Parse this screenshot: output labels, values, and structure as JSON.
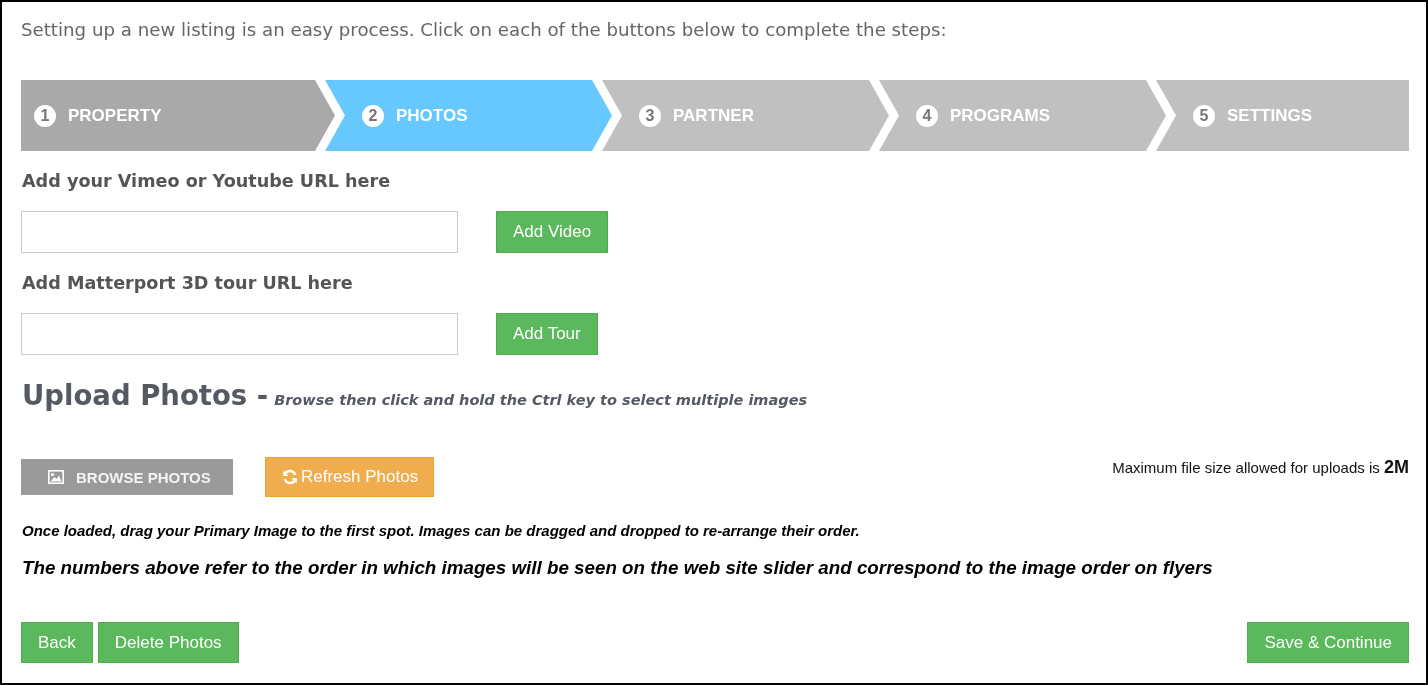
{
  "intro": "Setting up a new listing is an easy process. Click on each of the buttons below to complete the steps:",
  "steps": [
    {
      "number": "1",
      "label": "PROPERTY",
      "selected": false,
      "completed": true
    },
    {
      "number": "2",
      "label": "PHOTOS",
      "selected": true,
      "completed": false
    },
    {
      "number": "3",
      "label": "PARTNER",
      "selected": false,
      "completed": false
    },
    {
      "number": "4",
      "label": "PROGRAMS",
      "selected": false,
      "completed": false
    },
    {
      "number": "5",
      "label": "SETTINGS",
      "selected": false,
      "completed": false
    }
  ],
  "url_fields": [
    {
      "label": "Add your Vimeo or Youtube URL here",
      "button": "Add Video"
    },
    {
      "label": "Add Matterport 3D tour URL here",
      "button": "Add Tour"
    }
  ],
  "upload": {
    "title": "Upload Photos -",
    "hint": "Browse then click and hold the Ctrl key to select multiple images",
    "browse_button": "BROWSE PHOTOS",
    "refresh_button": "Refresh Photos",
    "max_size_note": "Maximum file size allowed for uploads is **2M**",
    "drag_note": "Once loaded, drag your Primary Image to the first spot. Images can be dragged and dropped to re-arrange their order.",
    "order_note": "The numbers above refer to the order in which images will be seen on the web site slider and correspond to the image order on flyers"
  },
  "footer": {
    "left_buttons": [
      "Back",
      "Delete Photos"
    ],
    "right_button": "Save & Continue"
  }
}
